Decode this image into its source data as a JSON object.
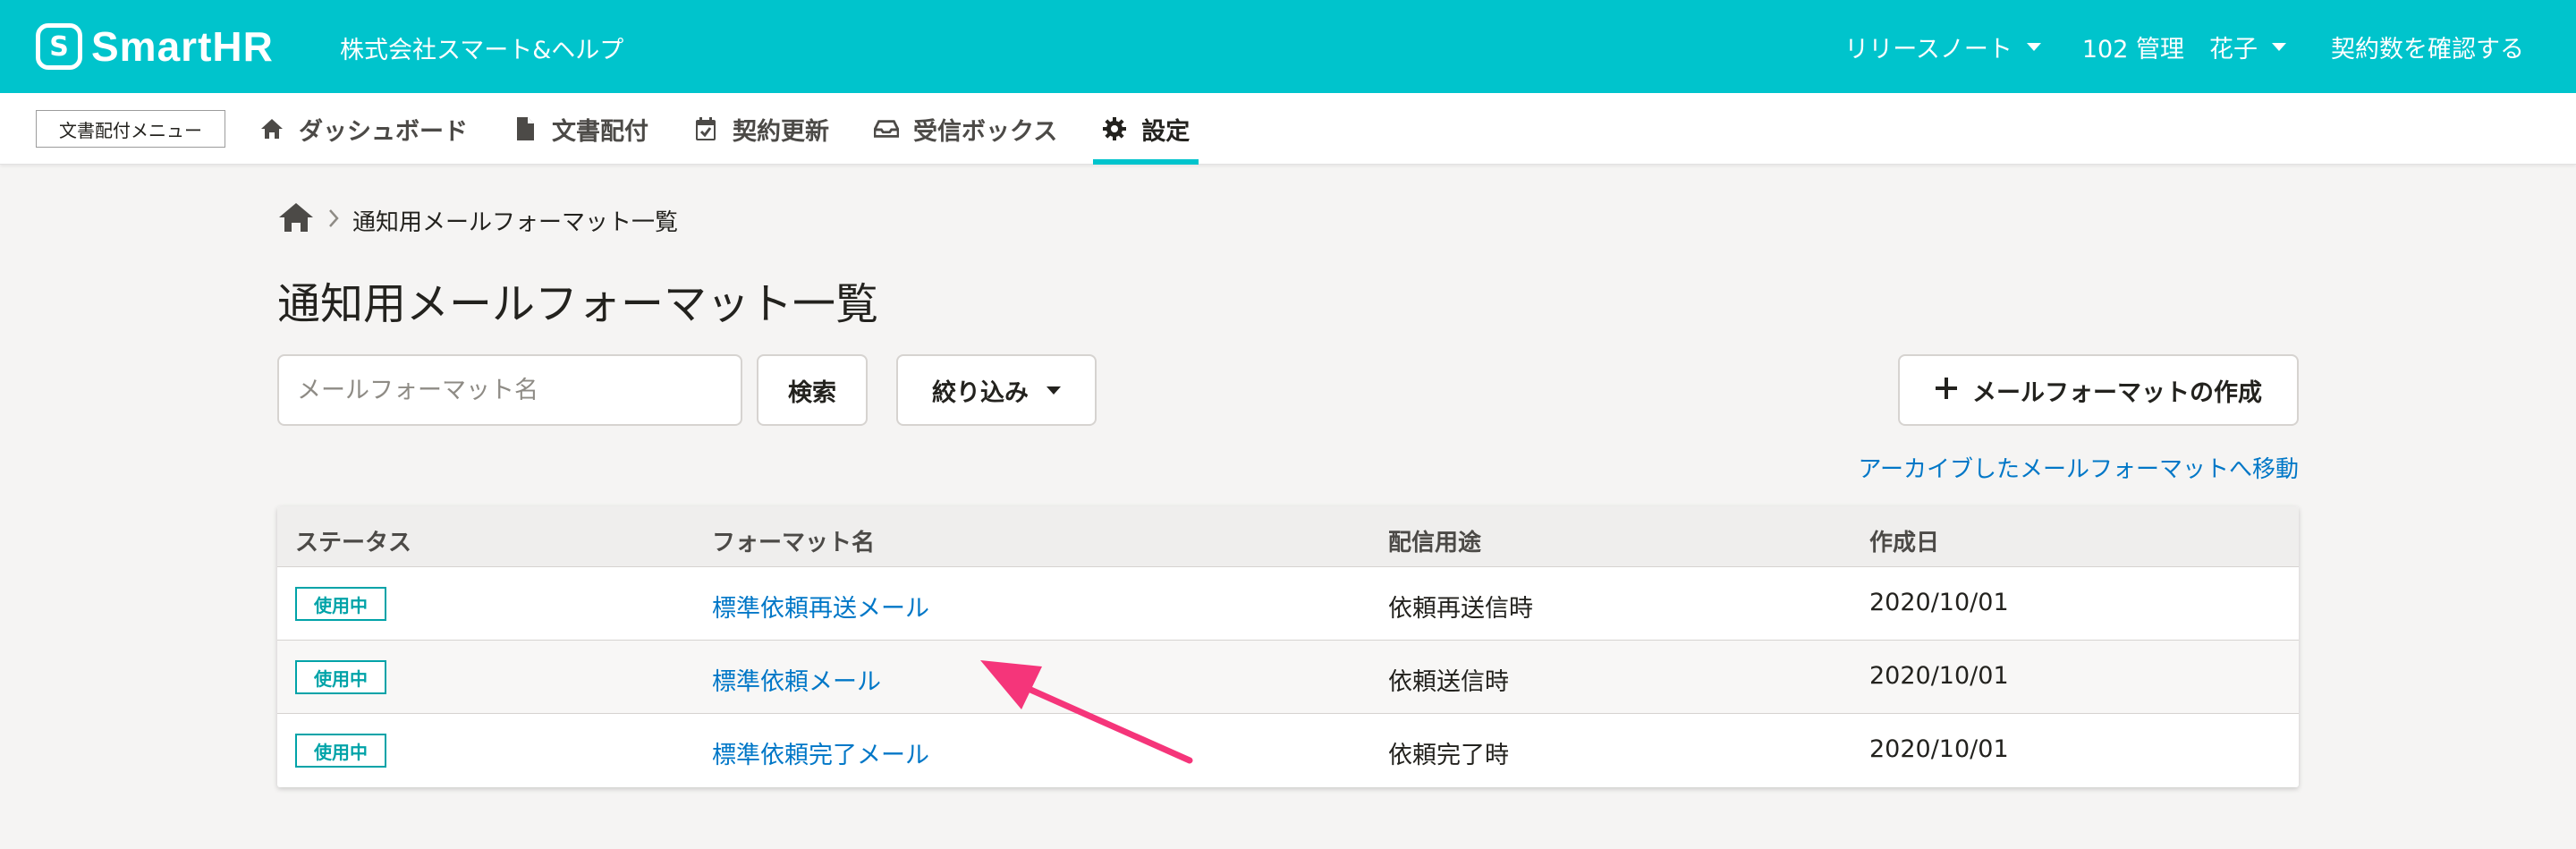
{
  "header": {
    "logo_mark": "S",
    "logo_text": "SmartHR",
    "company": "株式会社スマート&ヘルプ",
    "release_notes": "リリースノート",
    "user_id": "102 管理",
    "user_name": "花子",
    "contract": "契約数を確認する",
    "brand_color": "#00c4cc"
  },
  "appnav": {
    "menu_label": "文書配付メニュー",
    "tabs": [
      {
        "label": "ダッシュボード",
        "icon": "home-icon"
      },
      {
        "label": "文書配付",
        "icon": "document-icon"
      },
      {
        "label": "契約更新",
        "icon": "calendar-check-icon"
      },
      {
        "label": "受信ボックス",
        "icon": "inbox-icon"
      },
      {
        "label": "設定",
        "icon": "gear-icon",
        "active": true
      }
    ]
  },
  "breadcrumb": {
    "current": "通知用メールフォーマット一覧"
  },
  "page": {
    "title": "通知用メールフォーマット一覧",
    "search_placeholder": "メールフォーマット名",
    "search_button": "検索",
    "filter_button": "絞り込み",
    "create_button": "メールフォーマットの作成",
    "archive_link": "アーカイブしたメールフォーマットへ移動"
  },
  "table": {
    "headers": [
      "ステータス",
      "フォーマット名",
      "配信用途",
      "作成日"
    ],
    "rows": [
      {
        "status": "使用中",
        "name": "標準依頼再送メール",
        "usage": "依頼再送信時",
        "date": "2020/10/01"
      },
      {
        "status": "使用中",
        "name": "標準依頼メール",
        "usage": "依頼送信時",
        "date": "2020/10/01"
      },
      {
        "status": "使用中",
        "name": "標準依頼完了メール",
        "usage": "依頼完了時",
        "date": "2020/10/01"
      }
    ]
  },
  "colors": {
    "accent": "#00c4cc",
    "link": "#0077c7",
    "status_badge": "#00a3a8",
    "annotation_arrow": "#f5357a"
  }
}
